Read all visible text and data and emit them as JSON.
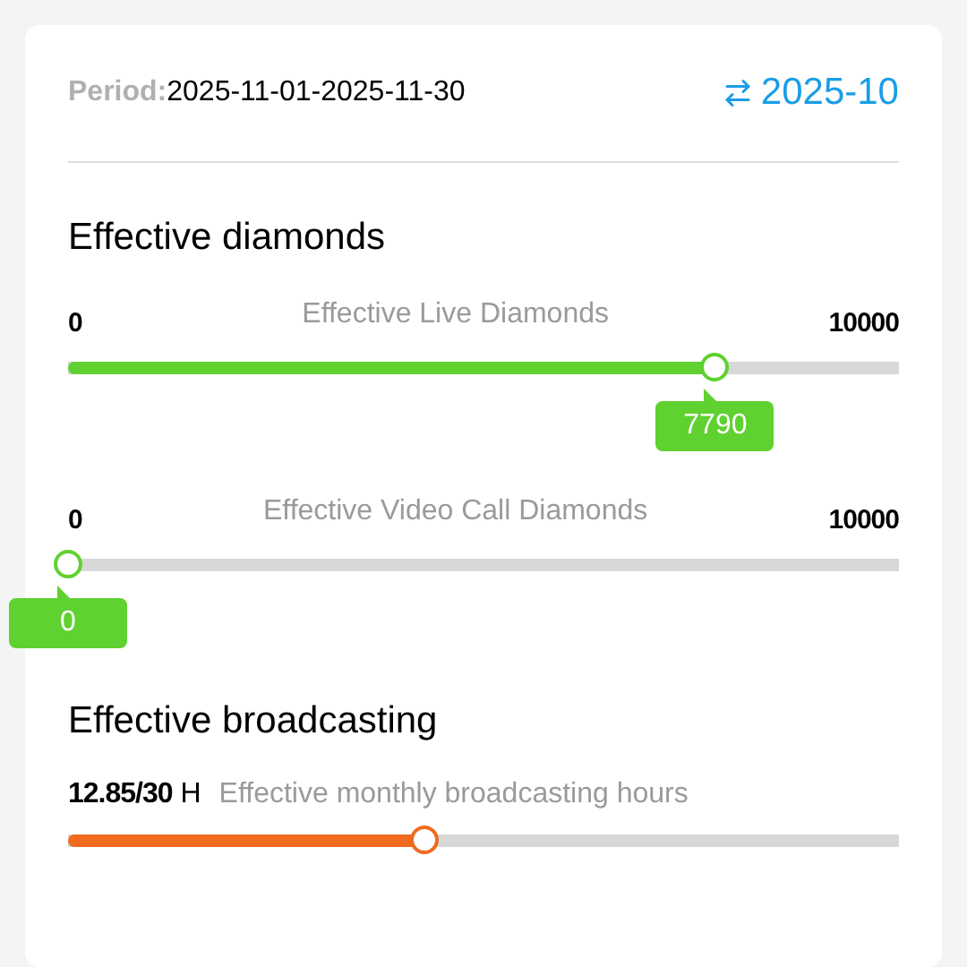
{
  "period": {
    "label": "Period:",
    "value": "2025-11-01-2025-11-30"
  },
  "switch": {
    "label": "2025-10"
  },
  "diamonds": {
    "title": "Effective diamonds",
    "sliders": [
      {
        "min": "0",
        "label": "Effective Live Diamonds",
        "max": "10000",
        "level": 0.779,
        "value": "7790"
      },
      {
        "min": "0",
        "label": "Effective Video Call Diamonds",
        "max": "10000",
        "level": 0,
        "value": "0"
      }
    ]
  },
  "broadcasting": {
    "title": "Effective broadcasting",
    "reading": "12.85/30",
    "unit": "H",
    "label": "Effective monthly broadcasting hours",
    "level": 0.428
  }
}
